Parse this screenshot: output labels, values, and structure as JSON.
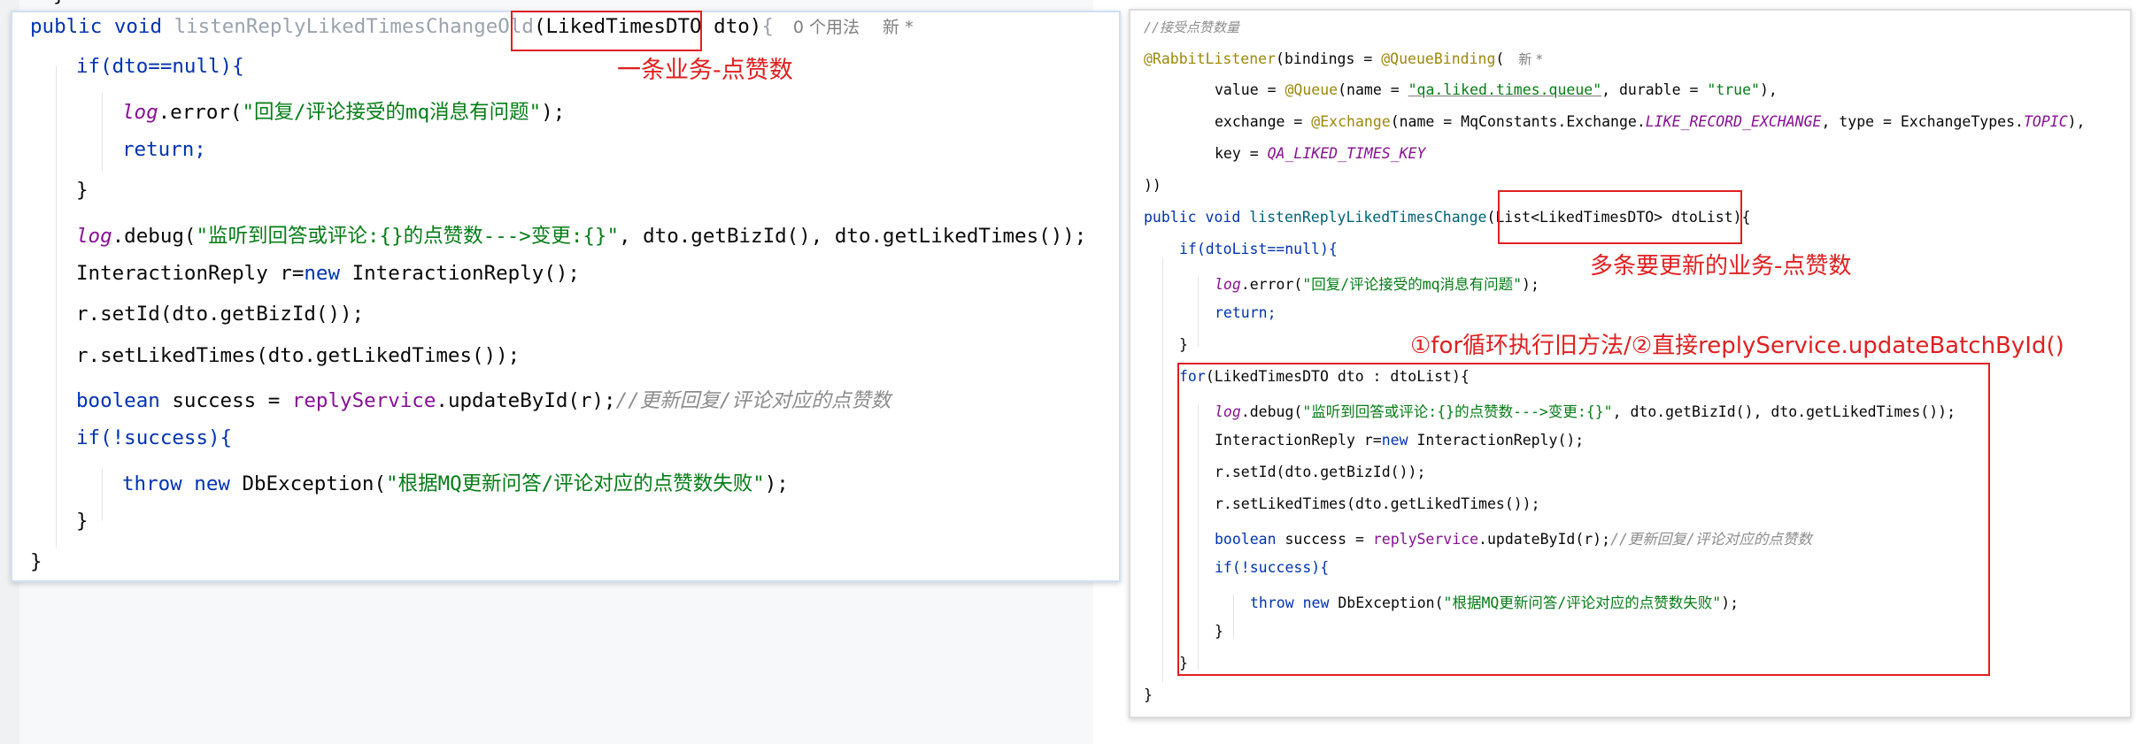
{
  "left": {
    "stub": "}",
    "sig_kw": "public void ",
    "sig_method": "listenReplyLikedTimesChangeOld",
    "sig_params": "(LikedTimesDTO dto)",
    "sig_brace": "{",
    "hint_usages": "0 个用法",
    "hint_new": "新 *",
    "if1": "if(dto==null){",
    "log_kw": "log",
    "log_error_rest": ".error(",
    "log_error_str": "\"回复/评论接受的mq消息有问题\"",
    "log_error_end": ");",
    "ret": "return;",
    "close_brace": "}",
    "log_debug_rest": ".debug(",
    "log_debug_str": "\"监听到回答或评论:{}的点赞数--->变更:{}\"",
    "log_debug_end": ", dto.getBizId(), dto.getLikedTimes());",
    "new_line_a": "InteractionReply r=",
    "new_kw": "new",
    "new_line_b": " InteractionReply();",
    "set_id": "r.setId(dto.getBizId());",
    "set_liked": "r.setLikedTimes(dto.getLikedTimes());",
    "bool_kw": "boolean",
    "bool_var": " success = ",
    "svc": "replyService",
    "update_call": ".updateById(r);",
    "update_cmt": "//更新回复/评论对应的点赞数",
    "if2": "if(!success){",
    "throw_kw": "throw new",
    "throw_cls": " DbException(",
    "throw_str": "\"根据MQ更新问答/评论对应的点赞数失败\"",
    "throw_end": ");",
    "annotation": "一条业务-点赞数"
  },
  "right": {
    "comment_top": "//接受点赞数量",
    "rl_ann": "@RabbitListener",
    "rl_rest": "(bindings = ",
    "qb_ann": "@QueueBinding",
    "qb_paren": "(",
    "hint_new": "新 *",
    "value_a": "value = ",
    "queue_ann": "@Queue",
    "value_b": "(name = ",
    "queue_name": "\"qa.liked.times.queue\"",
    "value_c": ", durable = ",
    "durable_val": "\"true\"",
    "value_d": "),",
    "exch_a": "exchange = ",
    "exch_ann": "@Exchange",
    "exch_b": "(name = MqConstants.Exchange.",
    "exch_const": "LIKE_RECORD_EXCHANGE",
    "exch_c": ", type = ExchangeTypes.",
    "exch_type": "TOPIC",
    "exch_d": "),",
    "key_a": "key = ",
    "key_const": "QA_LIKED_TIMES_KEY",
    "close_ann": "))",
    "sig_kw": "public void ",
    "sig_method": "listenReplyLikedTimesChange",
    "sig_params": "(List<LikedTimesDTO> dtoList)",
    "sig_brace": "{",
    "if1": "if(dtoList==null){",
    "log_kw": "log",
    "log_error_rest": ".error(",
    "log_error_str": "\"回复/评论接受的mq消息有问题\"",
    "log_error_end": ");",
    "ret": "return;",
    "close_brace": "}",
    "for_kw": "for",
    "for_rest": "(LikedTimesDTO dto : dtoList){",
    "log_debug_rest": ".debug(",
    "log_debug_str": "\"监听到回答或评论:{}的点赞数--->变更:{}\"",
    "log_debug_end": ", dto.getBizId(), dto.getLikedTimes());",
    "new_line_a": "InteractionReply r=",
    "new_kw": "new",
    "new_line_b": " InteractionReply();",
    "set_id": "r.setId(dto.getBizId());",
    "set_liked": "r.setLikedTimes(dto.getLikedTimes());",
    "bool_kw": "boolean",
    "bool_var": " success = ",
    "svc": "replyService",
    "update_call": ".updateById(r);",
    "update_cmt": "//更新回复/评论对应的点赞数",
    "if2": "if(!success){",
    "throw_kw": "throw new",
    "throw_cls": " DbException(",
    "throw_str": "\"根据MQ更新问答/评论对应的点赞数失败\"",
    "throw_end": ");",
    "annotation_multi": "多条要更新的业务-点赞数",
    "annotation_methods": "①for循环执行旧方法/②直接replyService.updateBatchById()"
  },
  "colors": {
    "keyword": "#0033b3",
    "string": "#067d17",
    "field": "#871094",
    "annotation": "#9e880d",
    "comment": "#8c8c8c",
    "highlight_box": "#e02020"
  }
}
